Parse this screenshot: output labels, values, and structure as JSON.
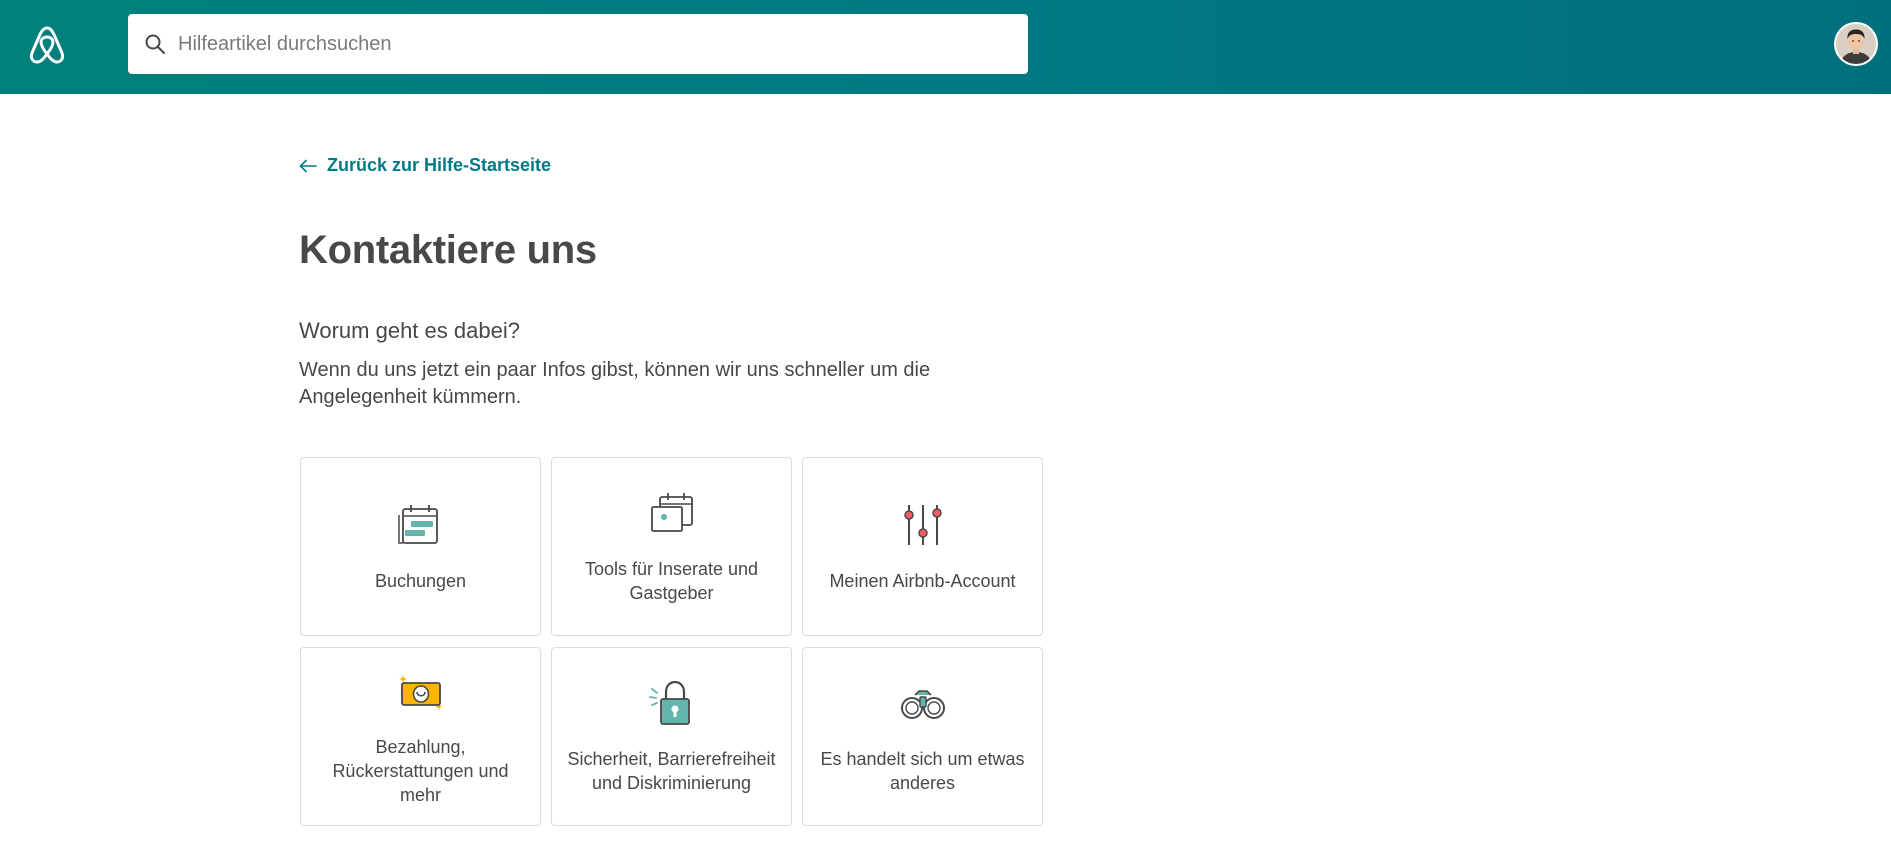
{
  "header": {
    "search_placeholder": "Hilfeartikel durchsuchen",
    "brand_color": "#00807c"
  },
  "back_link": {
    "label": "Zurück zur Hilfe-Startseite"
  },
  "page_title": "Kontaktiere uns",
  "section": {
    "title": "Worum geht es dabei?",
    "description": "Wenn du uns jetzt ein paar Infos gibst, können wir uns schneller um die Angelegenheit kümmern."
  },
  "topics": [
    {
      "label": "Buchungen",
      "icon": "calendar-booking-icon"
    },
    {
      "label": "Tools für Inserate und Gastgeber",
      "icon": "calendar-photo-icon"
    },
    {
      "label": "Meinen Airbnb-Account",
      "icon": "sliders-icon"
    },
    {
      "label": "Bezahlung, Rückerstattungen und mehr",
      "icon": "money-icon"
    },
    {
      "label": "Sicherheit, Barrierefreiheit und Diskriminierung",
      "icon": "padlock-icon"
    },
    {
      "label": "Es handelt sich um etwas anderes",
      "icon": "binoculars-icon"
    }
  ]
}
